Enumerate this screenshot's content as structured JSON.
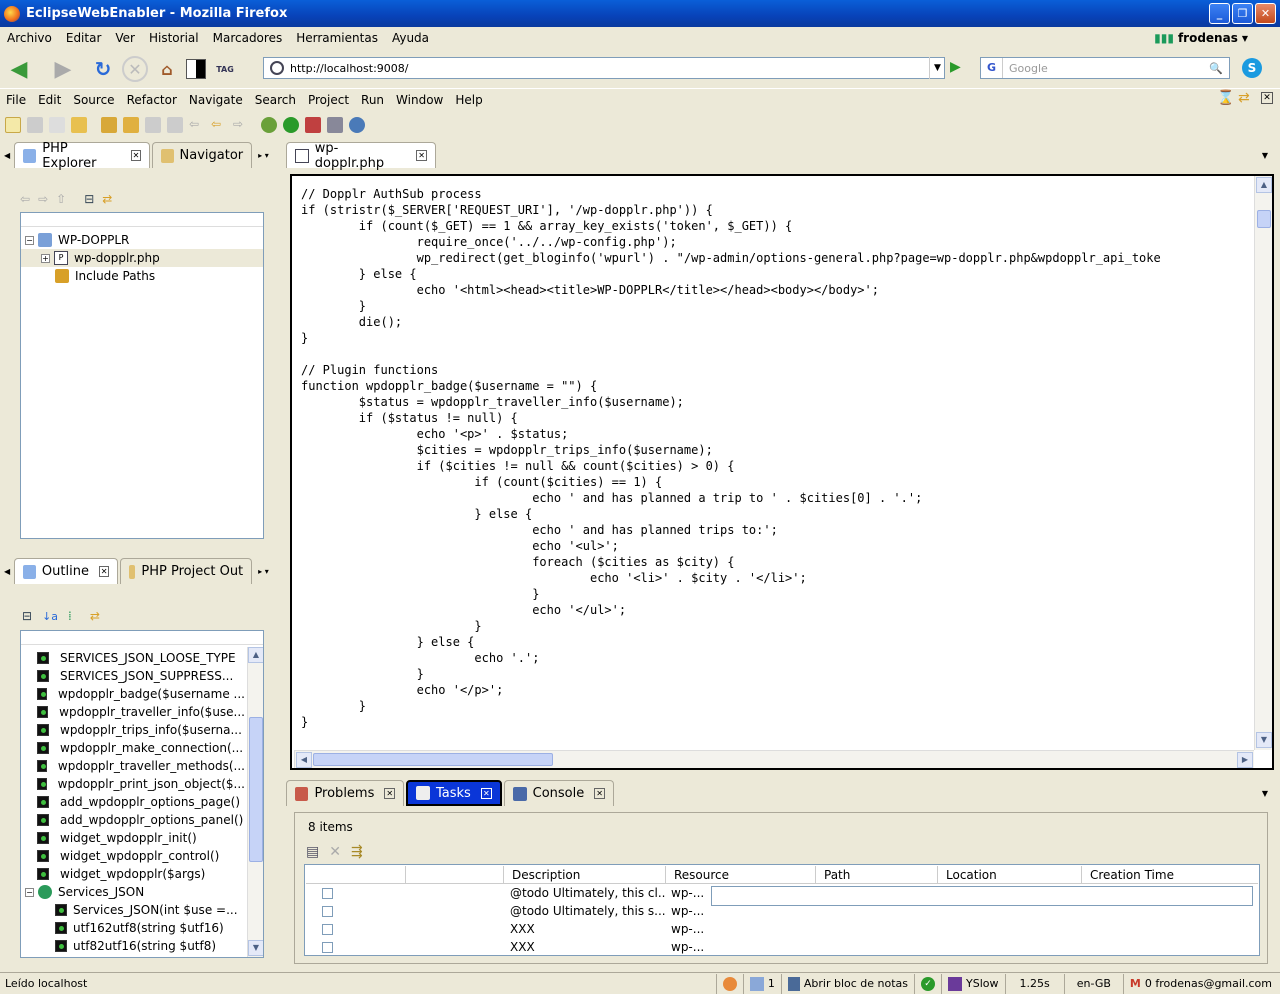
{
  "window": {
    "title": "EclipseWebEnabler - Mozilla Firefox"
  },
  "browser_menu": [
    "Archivo",
    "Editar",
    "Ver",
    "Historial",
    "Marcadores",
    "Herramientas",
    "Ayuda"
  ],
  "user": {
    "name": "frodenas"
  },
  "address": {
    "url": "http://localhost:9008/"
  },
  "search": {
    "placeholder": "Google"
  },
  "eclipse_menu": [
    "File",
    "Edit",
    "Source",
    "Refactor",
    "Navigate",
    "Search",
    "Project",
    "Run",
    "Window",
    "Help"
  ],
  "left_tabs": {
    "php_explorer": "PHP Explorer",
    "navigator": "Navigator"
  },
  "editor_tab": {
    "label": "wp-dopplr.php"
  },
  "explorer_tree": {
    "project": "WP-DOPPLR",
    "file": "wp-dopplr.php",
    "include": "Include Paths"
  },
  "outline_tabs": {
    "outline": "Outline",
    "project_outline": "PHP Project Out"
  },
  "outline_items": [
    "SERVICES_JSON_LOOSE_TYPE",
    "SERVICES_JSON_SUPPRESS...",
    "wpdopplr_badge($username ...",
    "wpdopplr_traveller_info($use...",
    "wpdopplr_trips_info($userna...",
    "wpdopplr_make_connection(...",
    "wpdopplr_traveller_methods(...",
    "wpdopplr_print_json_object($...",
    "add_wpdopplr_options_page()",
    "add_wpdopplr_options_panel()",
    "widget_wpdopplr_init()",
    "widget_wpdopplr_control()",
    "widget_wpdopplr($args)"
  ],
  "outline_class": {
    "name": "Services_JSON",
    "children": [
      "Services_JSON(int $use =...",
      "utf162utf8(string $utf16)",
      "utf82utf16(string $utf8)"
    ]
  },
  "code_lines": [
    "// Dopplr AuthSub process",
    "if (stristr($_SERVER['REQUEST_URI'], '/wp-dopplr.php')) {",
    "        if (count($_GET) == 1 && array_key_exists('token', $_GET)) {",
    "                require_once('../../wp-config.php');",
    "                wp_redirect(get_bloginfo('wpurl') . \"/wp-admin/options-general.php?page=wp-dopplr.php&wpdopplr_api_toke",
    "        } else {",
    "                echo '<html><head><title>WP-DOPPLR</title></head><body></body>';",
    "        }",
    "        die();",
    "}",
    "",
    "// Plugin functions",
    "function wpdopplr_badge($username = \"\") {",
    "        $status = wpdopplr_traveller_info($username);",
    "        if ($status != null) {",
    "                echo '<p>' . $status;",
    "                $cities = wpdopplr_trips_info($username);",
    "                if ($cities != null && count($cities) > 0) {",
    "                        if (count($cities) == 1) {",
    "                                echo ' and has planned a trip to ' . $cities[0] . '.';",
    "                        } else {",
    "                                echo ' and has planned trips to:';",
    "                                echo '<ul>';",
    "                                foreach ($cities as $city) {",
    "                                        echo '<li>' . $city . '</li>';",
    "                                }",
    "                                echo '</ul>';",
    "                        }",
    "                } else {",
    "                        echo '.';",
    "                }",
    "                echo '</p>';",
    "        }",
    "}"
  ],
  "bottom_tabs": {
    "problems": "Problems",
    "tasks": "Tasks",
    "console": "Console"
  },
  "tasks": {
    "count": "8 items",
    "columns": [
      "Description",
      "Resource",
      "Path",
      "Location",
      "Creation Time"
    ],
    "rows": [
      {
        "description": "@todo Ultimately, this cl...",
        "resource": "wp-..."
      },
      {
        "description": "@todo Ultimately, this s...",
        "resource": "wp-..."
      },
      {
        "description": "XXX",
        "resource": "wp-..."
      },
      {
        "description": "XXX",
        "resource": "wp-..."
      }
    ]
  },
  "statusbar": {
    "left": "Leído localhost",
    "count": "1",
    "notes": "Abrir bloc de notas",
    "yslow": "YSlow",
    "time": "1.25s",
    "locale": "en-GB",
    "mail": "0 frodenas@gmail.com"
  }
}
